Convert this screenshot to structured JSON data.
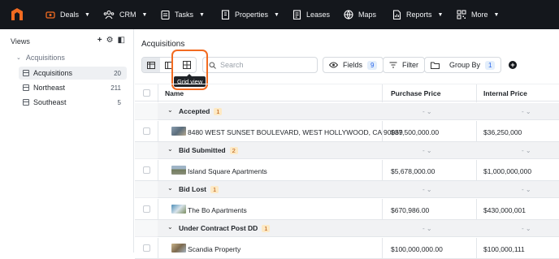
{
  "nav": {
    "items": [
      {
        "label": "Deals",
        "icon": "deals-icon",
        "dropdown": true
      },
      {
        "label": "CRM",
        "icon": "crm-icon",
        "dropdown": true
      },
      {
        "label": "Tasks",
        "icon": "tasks-icon",
        "dropdown": true
      },
      {
        "label": "Properties",
        "icon": "properties-icon",
        "dropdown": true
      },
      {
        "label": "Leases",
        "icon": "leases-icon",
        "dropdown": false
      },
      {
        "label": "Maps",
        "icon": "globe-icon",
        "dropdown": false
      },
      {
        "label": "Reports",
        "icon": "reports-icon",
        "dropdown": true
      },
      {
        "label": "More",
        "icon": "qr-icon",
        "dropdown": true
      }
    ],
    "accent": "#f26b21"
  },
  "sidebar": {
    "title": "Views",
    "group": "Acquisitions",
    "items": [
      {
        "label": "Acquisitions",
        "count": "20",
        "active": true
      },
      {
        "label": "Northeast",
        "count": "211",
        "active": false
      },
      {
        "label": "Southeast",
        "count": "5",
        "active": false
      }
    ]
  },
  "main": {
    "title": "Acquisitions",
    "search_placeholder": "Search",
    "fields_label": "Fields",
    "fields_count": "9",
    "filter_label": "Filter",
    "groupby_label": "Group By",
    "groupby_count": "1",
    "tooltip": "Grid view"
  },
  "table": {
    "columns": [
      "Name",
      "Purchase Price",
      "Internal Price"
    ],
    "groups": [
      {
        "label": "Accepted",
        "count": "1",
        "rows": [
          {
            "name": "8480 WEST SUNSET BOULEVARD, WEST HOLLYWOOD, CA 90069",
            "purchase": "$37,500,000.00",
            "internal": "$36,250,000"
          }
        ]
      },
      {
        "label": "Bid Submitted",
        "count": "2",
        "rows": [
          {
            "name": "Island Square Apartments",
            "purchase": "$5,678,000.00",
            "internal": "$1,000,000,000"
          }
        ]
      },
      {
        "label": "Bid Lost",
        "count": "1",
        "rows": [
          {
            "name": "The Bo Apartments",
            "purchase": "$670,986.00",
            "internal": "$430,000,001"
          }
        ]
      },
      {
        "label": "Under Contract Post DD",
        "count": "1",
        "rows": [
          {
            "name": "Scandia Property",
            "purchase": "$100,000,000.00",
            "internal": "$100,000,111"
          }
        ]
      }
    ]
  }
}
